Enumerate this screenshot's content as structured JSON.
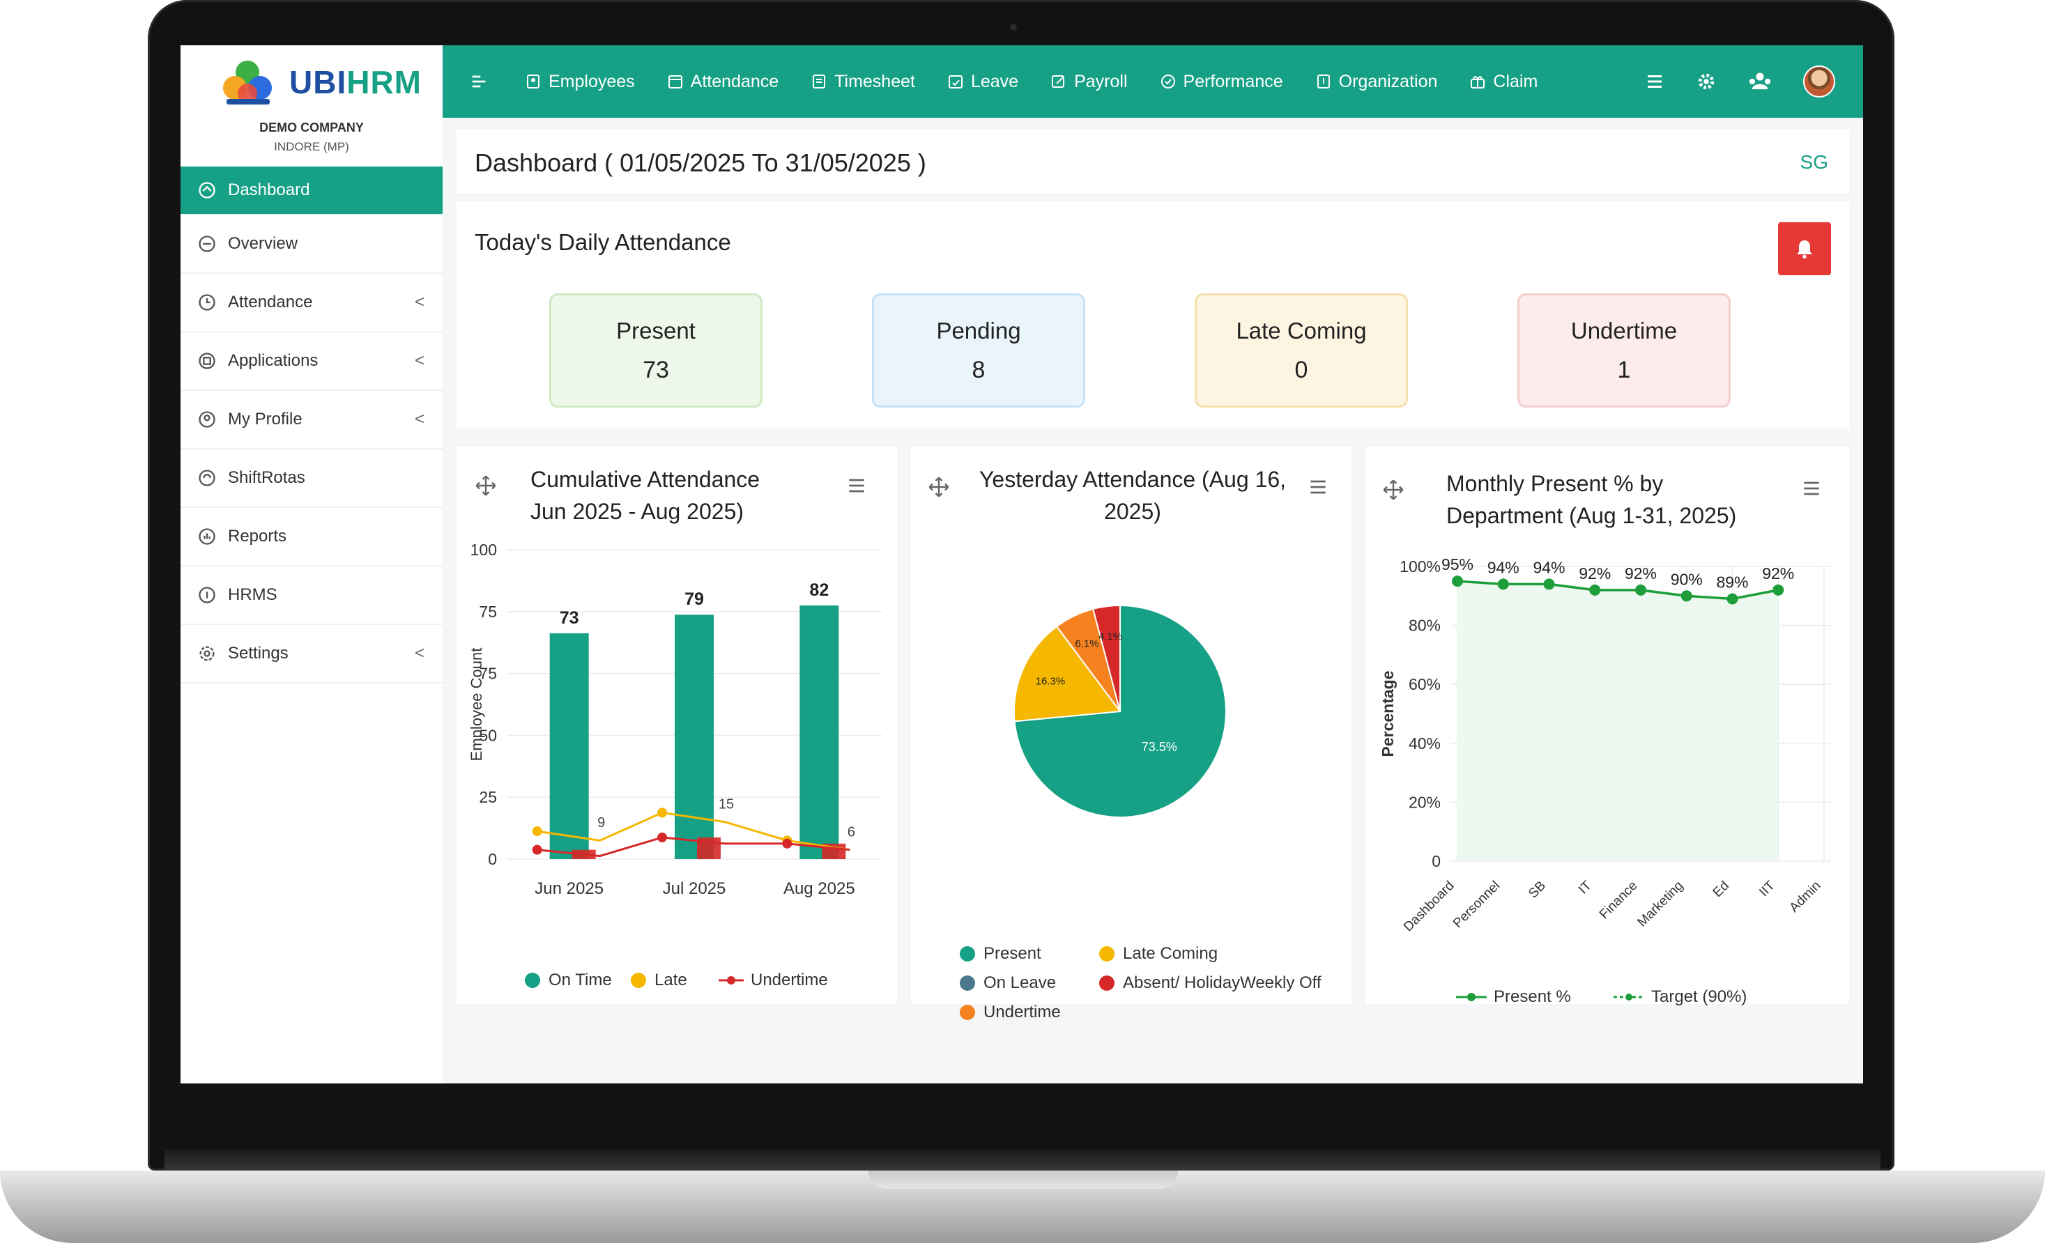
{
  "app": {
    "logo_prefix": "UBI",
    "logo_suffix": "HRM",
    "company": "DEMO COMPANY",
    "location": "INDORE (MP)"
  },
  "sidebar": {
    "items": [
      {
        "label": "Dashboard",
        "icon": "dashboard-icon",
        "active": true
      },
      {
        "label": "Overview",
        "icon": "overview-icon"
      },
      {
        "label": "Attendance",
        "icon": "clock-icon",
        "chevron": "<"
      },
      {
        "label": "Applications",
        "icon": "applications-icon",
        "chevron": "<"
      },
      {
        "label": "My Profile",
        "icon": "profile-icon",
        "chevron": "<"
      },
      {
        "label": "ShiftRotas",
        "icon": "shift-icon"
      },
      {
        "label": "Reports",
        "icon": "reports-icon"
      },
      {
        "label": "HRMS",
        "icon": "hrms-icon"
      },
      {
        "label": "Settings",
        "icon": "settings-icon",
        "chevron": "<"
      }
    ]
  },
  "topnav": {
    "items": [
      {
        "label": "Employees"
      },
      {
        "label": "Attendance"
      },
      {
        "label": "Timesheet"
      },
      {
        "label": "Leave"
      },
      {
        "label": "Payroll"
      },
      {
        "label": "Performance"
      },
      {
        "label": "Organization"
      },
      {
        "label": "Claim"
      }
    ]
  },
  "dashboard": {
    "title": "Dashboard ( 01/05/2025 To 31/05/2025 )",
    "user_initials": "SG"
  },
  "daily": {
    "title": "Today's Daily Attendance",
    "stats": [
      {
        "label": "Present",
        "value": "73",
        "bg": "#eef8ea",
        "border": "#cfe9c4"
      },
      {
        "label": "Pending",
        "value": "8",
        "bg": "#eaf4fb",
        "border": "#c7e2f4"
      },
      {
        "label": "Late Coming",
        "value": "0",
        "bg": "#fdf5e1",
        "border": "#f3e1ad"
      },
      {
        "label": "Undertime",
        "value": "1",
        "bg": "#fcecec",
        "border": "#f3cfcf"
      }
    ]
  },
  "colors": {
    "primary": "#16a085",
    "late": "#f5b700",
    "undertime": "#d62828",
    "leave": "#4a7a8c",
    "under_orange": "#f5821f",
    "green_line": "#1e9e3a"
  },
  "chart_data": [
    {
      "type": "bar",
      "title_line1": "Cumulative Attendance",
      "title_line2": "Jun 2025 - Aug 2025)",
      "ylabel": "Employee Count",
      "yticks": [
        "100",
        "75",
        "75",
        "50",
        "25",
        "0"
      ],
      "ylim": [
        0,
        100
      ],
      "categories": [
        "Jun 2025",
        "Jul 2025",
        "Aug 2025"
      ],
      "series": [
        {
          "name": "On Time",
          "values": [
            73,
            79,
            82
          ]
        },
        {
          "name": "Late",
          "values": [
            9,
            15,
            6
          ]
        },
        {
          "name": "Undertime",
          "values": [
            3,
            7,
            5
          ]
        }
      ],
      "bar_labels": [
        "73",
        "79",
        "82"
      ],
      "late_labels": [
        "9",
        "15",
        "6"
      ]
    },
    {
      "type": "pie",
      "title_line1": "Yesterday Attendance (Aug 16,",
      "title_line2": "2025)",
      "slices": [
        {
          "name": "Present",
          "value": 73.5,
          "label": "73.5%"
        },
        {
          "name": "On Leave",
          "value": 0,
          "label": ""
        },
        {
          "name": "Late Coming",
          "value": 16.3,
          "label": "16.3%"
        },
        {
          "name": "Undertime",
          "value": 6.1,
          "label": "6.1%"
        },
        {
          "name": "Absent/ HolidayWeekly Off",
          "value": 4.1,
          "label": "4.1%"
        }
      ]
    },
    {
      "type": "line",
      "title_line1": "Monthly Present % by",
      "title_line2": "Department (Aug 1-31, 2025)",
      "ylabel": "Percentage",
      "yticks": [
        "100%",
        "80%",
        "60%",
        "40%",
        "20%",
        "0"
      ],
      "ylim": [
        0,
        100
      ],
      "categories": [
        "Dashboard",
        "Personnel",
        "SB",
        "IT",
        "Finance",
        "Marketing",
        "Ed",
        "IIT",
        "Admin"
      ],
      "series": [
        {
          "name": "Present %",
          "values": [
            95,
            94,
            94,
            92,
            92,
            90,
            89,
            92
          ]
        },
        {
          "name": "Target (90%)",
          "values": []
        }
      ],
      "point_labels": [
        "95%",
        "94%",
        "94%",
        "92%",
        "92%",
        "90%",
        "89%",
        "92%"
      ]
    }
  ]
}
